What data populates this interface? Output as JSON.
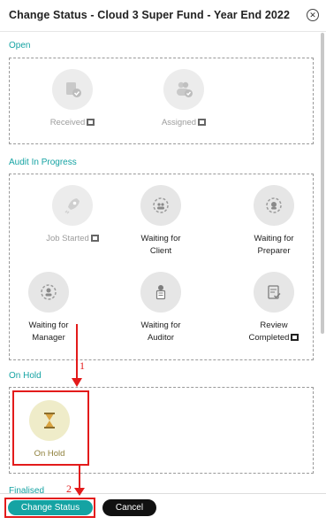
{
  "dialog": {
    "title": "Change Status - Cloud 3 Super Fund - Year End 2022",
    "close_icon": "close-icon"
  },
  "sections": {
    "open": {
      "title": "Open",
      "items": [
        {
          "label": "Received",
          "icon": "document-check-icon",
          "flag": true,
          "muted": true
        },
        {
          "label": "Assigned",
          "icon": "users-check-icon",
          "flag": true,
          "muted": true
        }
      ]
    },
    "audit": {
      "title": "Audit In Progress",
      "items": [
        {
          "label": "Job Started",
          "icon": "rocket-icon",
          "flag": true,
          "muted": true
        },
        {
          "label": "Waiting for Client",
          "icon": "client-wait-icon",
          "flag": false,
          "muted": false
        },
        {
          "label": "Waiting for Preparer",
          "icon": "preparer-wait-icon",
          "flag": false,
          "muted": false
        },
        {
          "label": "Waiting for Manager",
          "icon": "manager-wait-icon",
          "flag": false,
          "muted": false
        },
        {
          "label": "Waiting for Auditor",
          "icon": "auditor-icon",
          "flag": false,
          "muted": false
        },
        {
          "label": "Review Completed",
          "icon": "review-completed-icon",
          "flag": true,
          "muted": false
        }
      ]
    },
    "onhold": {
      "title": "On Hold",
      "items": [
        {
          "label": "On Hold",
          "icon": "hourglass-icon",
          "selected": true
        }
      ]
    },
    "finalised": {
      "title": "Finalised"
    }
  },
  "annotations": {
    "step1": "1",
    "step2": "2"
  },
  "footer": {
    "change_status_label": "Change Status",
    "cancel_label": "Cancel"
  },
  "colors": {
    "accent": "#15a3a3",
    "highlight": "#e31b1b",
    "onhold": "#efecc9"
  }
}
